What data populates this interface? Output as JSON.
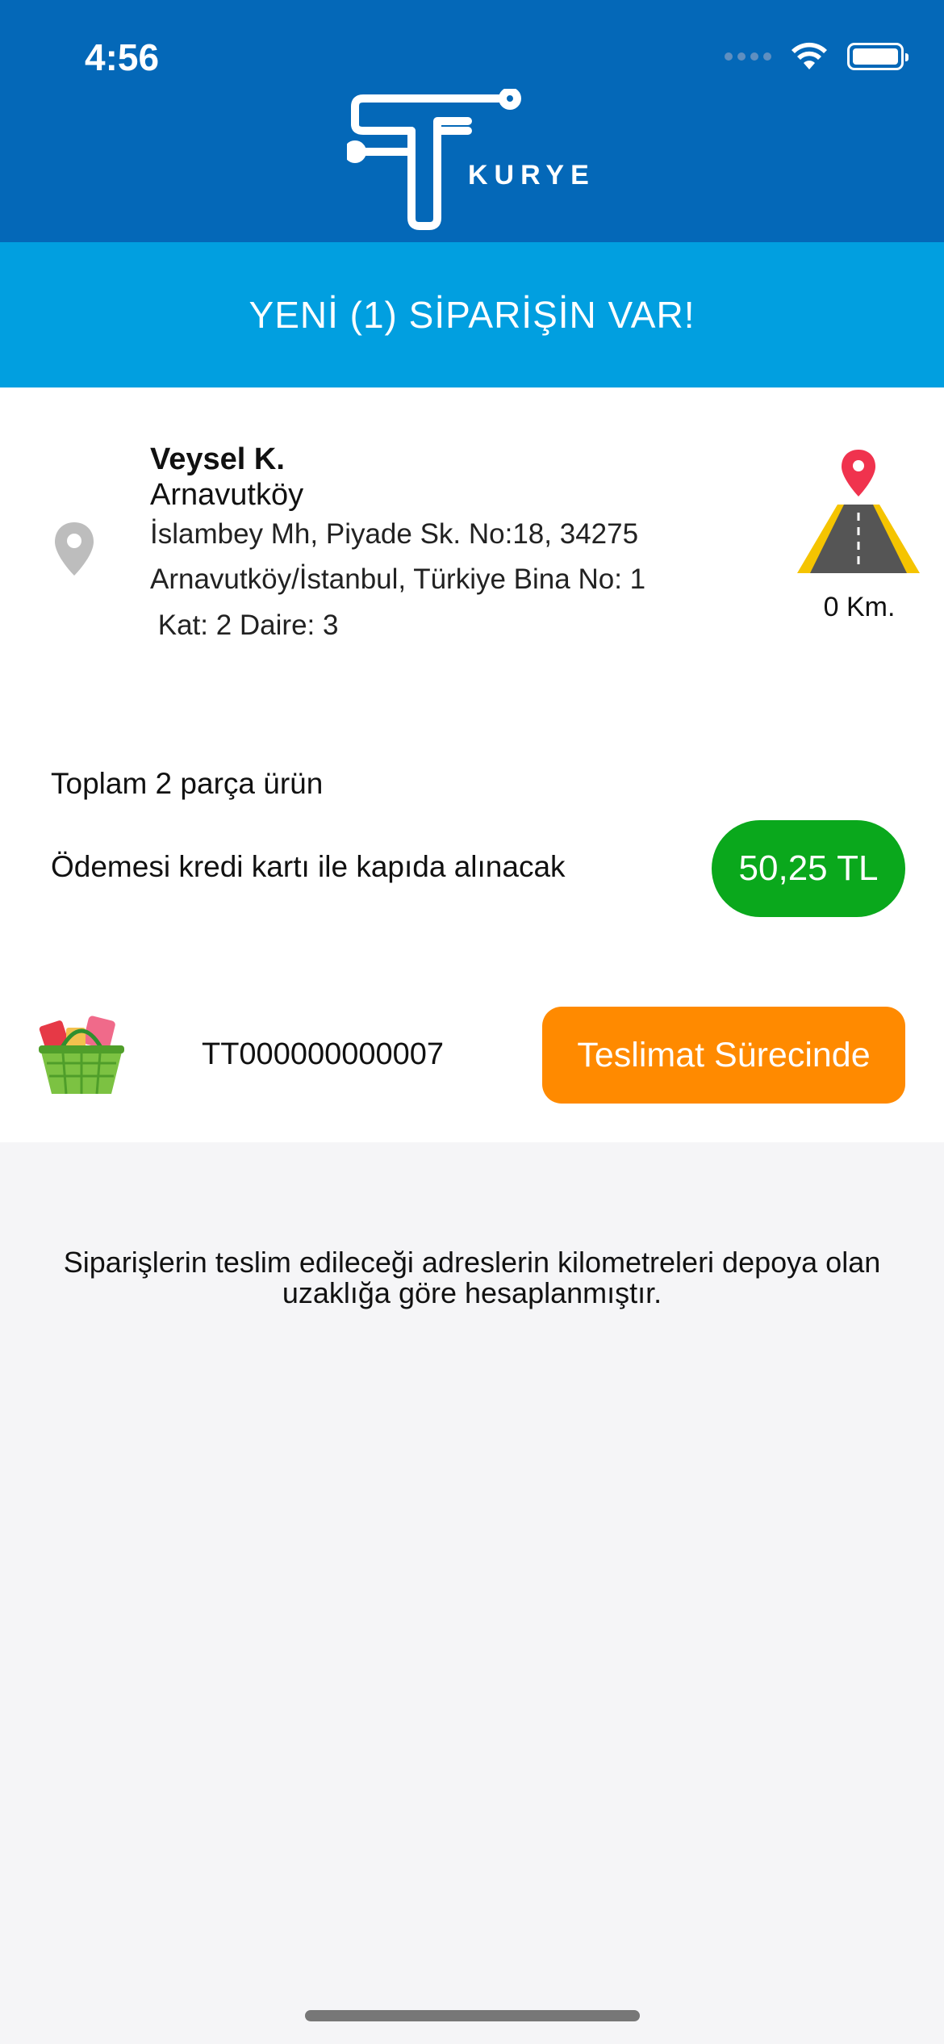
{
  "status_bar": {
    "time": "4:56"
  },
  "brand": {
    "logo_text": "KURYE"
  },
  "banner": {
    "text": "YENİ (1)  SİPARİŞİN VAR!"
  },
  "order": {
    "customer_name": "Veysel K.",
    "district": "Arnavutköy",
    "address_lines": [
      "İslambey Mh, Piyade Sk. No:18, 34275",
      "Arnavutköy/İstanbul, Türkiye Bina No: 1",
      " Kat: 2 Daire: 3"
    ],
    "distance": "0 Km.",
    "total_items": "Toplam 2 parça ürün",
    "payment_info": "Ödemesi kredi kartı ile kapıda alınacak",
    "price": "50,25 TL",
    "order_code": "TT000000000007",
    "status_button": "Teslimat Sürecinde"
  },
  "footnote": "Siparişlerin teslim edileceği adreslerin kilometreleri depoya olan uzaklığa göre hesaplanmıştır.",
  "icons": {
    "location": "location-pin-icon",
    "road": "road-icon",
    "basket": "basket-icon",
    "wifi": "wifi-icon",
    "battery": "battery-icon"
  },
  "colors": {
    "header": "#0468b8",
    "banner": "#019fe0",
    "price_badge": "#0aa81c",
    "status_button": "#ff8a00"
  }
}
